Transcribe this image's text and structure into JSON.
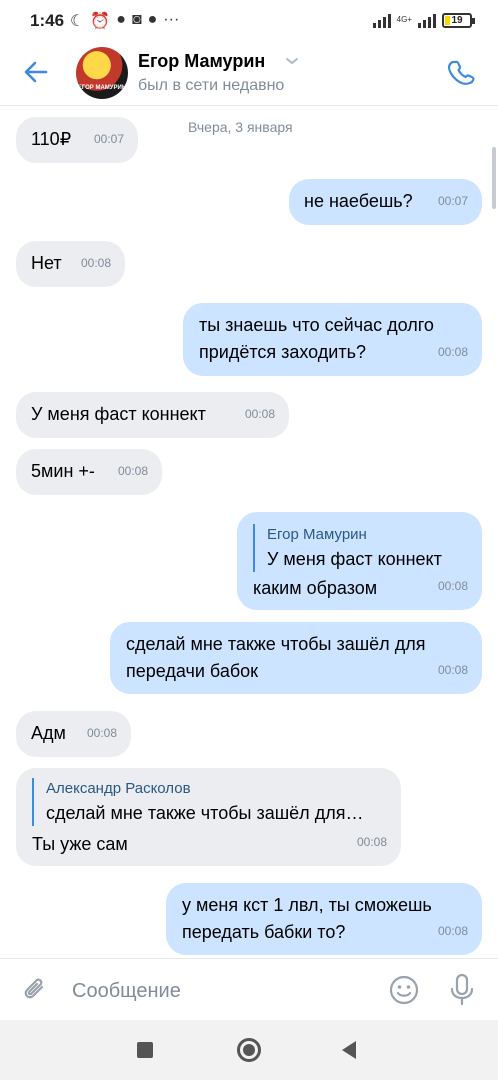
{
  "status_bar": {
    "time": "1:46",
    "battery": "19",
    "network": "4G+",
    "battery_level": 0.19
  },
  "header": {
    "name": "Егор Мамурин",
    "status": "был в сети недавно",
    "avatar_text": "ЕГОР МАМУРИН",
    "icons": [
      "back-arrow-icon",
      "chevron-down-icon",
      "phone-icon"
    ],
    "accent": "#3f8ae0"
  },
  "chat": {
    "date": "Вчера, 3 января",
    "messages": [
      {
        "dir": "in",
        "text": "110₽",
        "time": "00:07"
      },
      {
        "dir": "out",
        "text": "не наебешь?",
        "time": "00:07"
      },
      {
        "dir": "in",
        "text": "Нет",
        "time": "00:08"
      },
      {
        "dir": "out",
        "text": "ты знаешь что сейчас долго придётся заходить?",
        "time": "00:08"
      },
      {
        "dir": "in",
        "text": "У меня фаст коннект",
        "time": "00:08"
      },
      {
        "dir": "in",
        "text": "5мин +-",
        "time": "00:08"
      },
      {
        "dir": "out",
        "reply_name": "Егор Мамурин",
        "reply_text": "У меня фаст коннект",
        "text": "каким образом",
        "time": "00:08"
      },
      {
        "dir": "out",
        "text": "сделай мне также чтобы зашёл для передачи бабок",
        "time": "00:08"
      },
      {
        "dir": "in",
        "text": "Адм",
        "time": "00:08"
      },
      {
        "dir": "in",
        "reply_name": "Александр Расколов",
        "reply_text": "сделай мне также чтобы зашёл для…",
        "text": "Ты уже сам",
        "time": "00:08"
      },
      {
        "dir": "out",
        "text": "у меня кст 1 лвл, ты сможешь передать бабки то?",
        "time": "00:08"
      }
    ],
    "bubble_colors": {
      "in": "#ebedf0",
      "out": "#cce4ff"
    }
  },
  "composer": {
    "placeholder": "Сообщение",
    "icons": [
      "paperclip-icon",
      "smile-icon",
      "microphone-icon"
    ]
  },
  "nav": {
    "icons": [
      "recents-icon",
      "home-icon",
      "back-icon"
    ]
  }
}
